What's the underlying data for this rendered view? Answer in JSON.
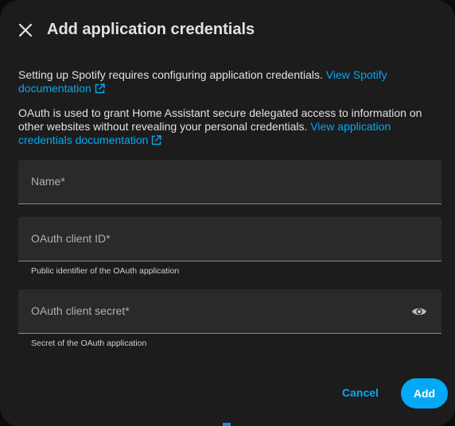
{
  "dialog": {
    "title": "Add application credentials",
    "close_icon": "close-icon"
  },
  "intro": {
    "text": "Setting up Spotify requires configuring application credentials. ",
    "link_part1": "View Spotify",
    "link_part2": "documentation",
    "link_icon": "open-in-new-icon"
  },
  "oauth_info": {
    "text": "OAuth is used to grant Home Assistant secure delegated access to information on other websites without revealing your personal credentials. ",
    "link_part1": "View application",
    "link_part2": "credentials documentation",
    "link_icon": "open-in-new-icon"
  },
  "fields": {
    "name": {
      "label": "Name*",
      "value": ""
    },
    "client_id": {
      "label": "OAuth client ID*",
      "helper": "Public identifier of the OAuth application",
      "value": ""
    },
    "client_secret": {
      "label": "OAuth client secret*",
      "helper": "Secret of the OAuth application",
      "value": "",
      "toggle_icon": "eye-icon"
    }
  },
  "actions": {
    "cancel_label": "Cancel",
    "add_label": "Add"
  },
  "colors": {
    "accent": "#03a9f4",
    "surface": "#1c1c1c",
    "field_bg": "#2a2a2a",
    "text": "#e1e1e1"
  }
}
